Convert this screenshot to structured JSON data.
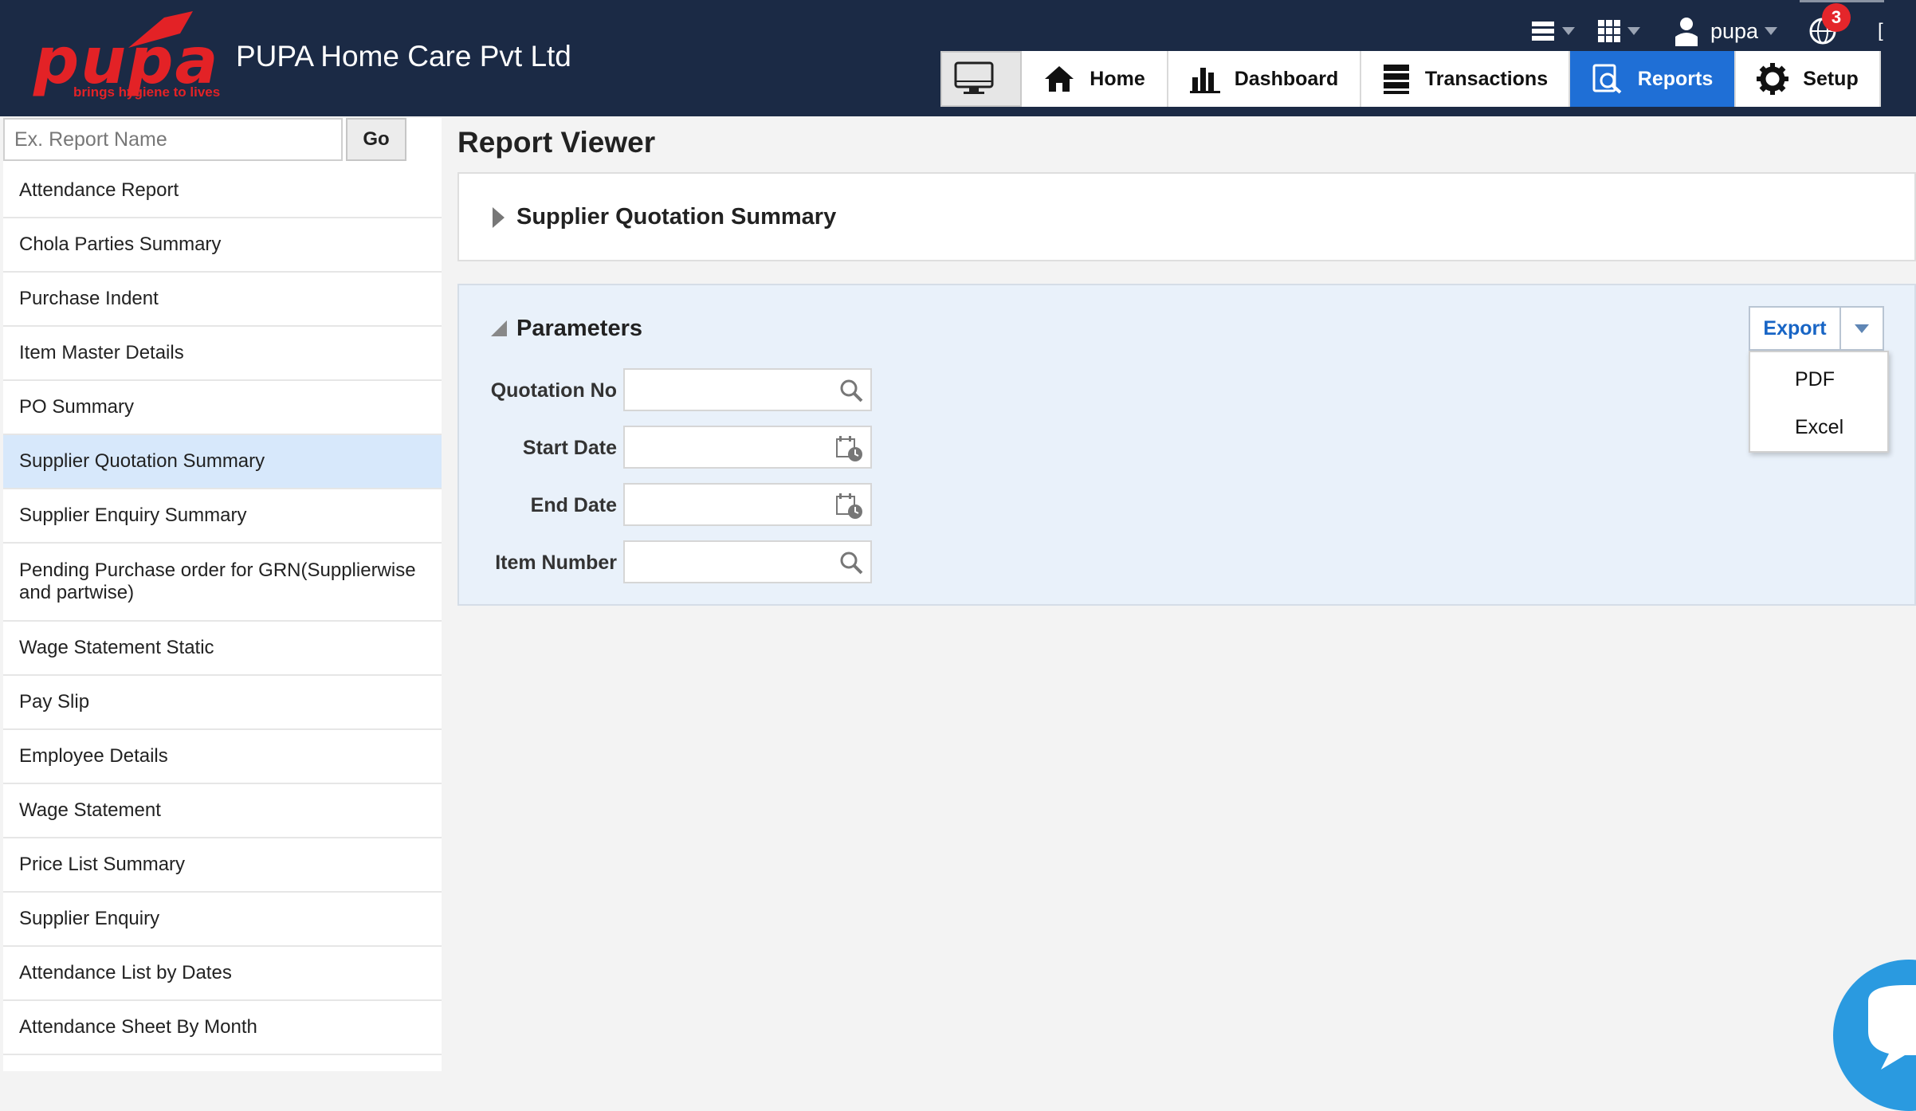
{
  "header": {
    "logo_text": "pupa",
    "logo_tagline": "brings hygiene to lives",
    "company_name": "PUPA Home Care Pvt Ltd",
    "user_name": "pupa",
    "notification_count": "3",
    "edge_glyph": "[",
    "icons": [
      "list-icon",
      "grid-icon",
      "user-icon",
      "globe-icon"
    ]
  },
  "nav": {
    "tabs": [
      {
        "label": "",
        "icon": "monitor-icon"
      },
      {
        "label": "Home",
        "icon": "home-icon"
      },
      {
        "label": "Dashboard",
        "icon": "bar-chart-icon"
      },
      {
        "label": "Transactions",
        "icon": "stack-icon"
      },
      {
        "label": "Reports",
        "icon": "report-search-icon",
        "active": true
      },
      {
        "label": "Setup",
        "icon": "gear-icon"
      }
    ]
  },
  "sidebar": {
    "search_placeholder": "Ex. Report Name",
    "go_label": "Go",
    "items": [
      "Attendance Report",
      "Chola Parties Summary",
      "Purchase Indent",
      "Item Master Details",
      "PO Summary",
      "Supplier Quotation Summary",
      "Supplier Enquiry Summary",
      "Pending Purchase order for GRN(Supplierwise and partwise)",
      "Wage Statement Static",
      "Pay Slip",
      "Employee Details",
      "Wage Statement",
      "Price List Summary",
      "Supplier Enquiry",
      "Attendance List by Dates",
      "Attendance Sheet By Month"
    ],
    "selected_index": 5
  },
  "main": {
    "title": "Report Viewer",
    "report_name": "Supplier Quotation Summary",
    "parameters_title": "Parameters",
    "fields": [
      {
        "label": "Quotation No",
        "value": "",
        "icon": "search-icon"
      },
      {
        "label": "Start Date",
        "value": "",
        "icon": "calendar-icon"
      },
      {
        "label": "End Date",
        "value": "",
        "icon": "calendar-icon"
      },
      {
        "label": "Item Number",
        "value": "",
        "icon": "search-icon"
      }
    ],
    "export_label": "Export",
    "export_options": [
      "PDF",
      "Excel"
    ]
  },
  "colors": {
    "header_bg": "#1b2a45",
    "accent_blue": "#1f6fd6",
    "brand_red": "#e32226",
    "selected_bg": "#d7e8fb",
    "params_bg": "#e9f1fa"
  }
}
